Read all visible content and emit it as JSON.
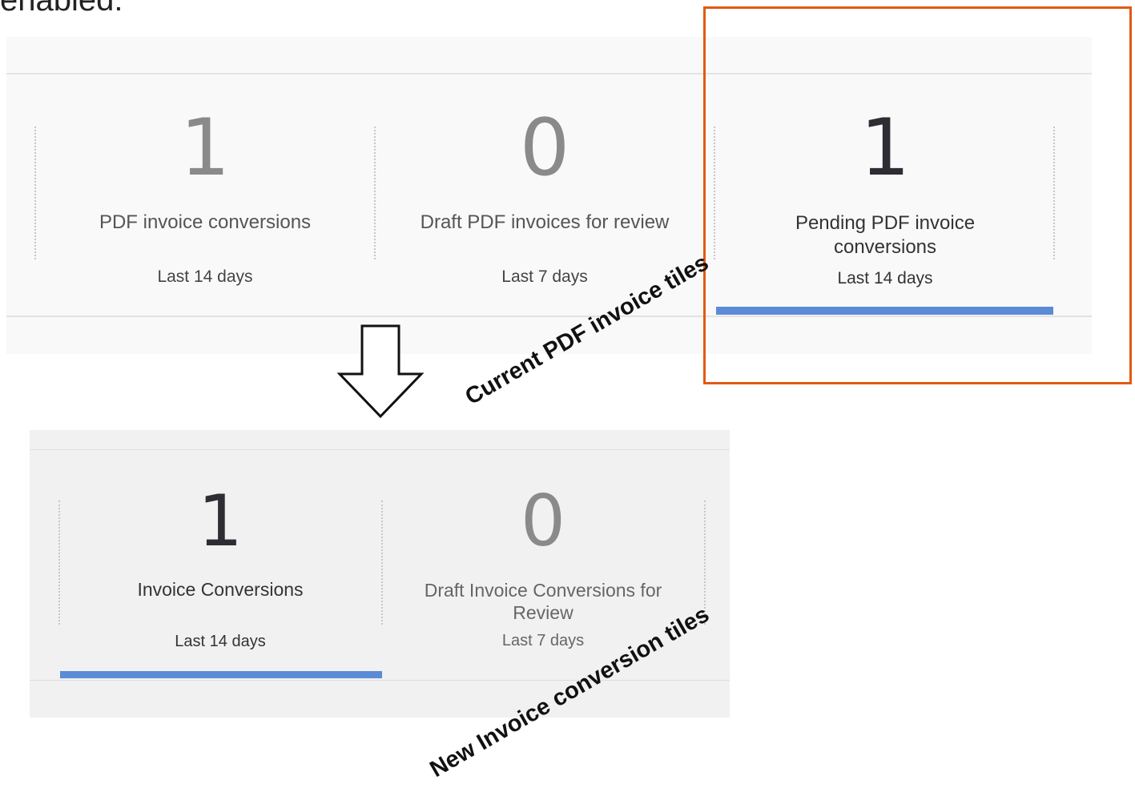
{
  "header_text": "enabled:",
  "current_tiles": [
    {
      "value": "1",
      "label": "PDF invoice conversions",
      "period": "Last 14 days"
    },
    {
      "value": "0",
      "label": "Draft PDF invoices for review",
      "period": "Last 7 days"
    },
    {
      "value": "1",
      "label": "Pending PDF invoice conversions",
      "period": "Last 14 days"
    }
  ],
  "new_tiles": [
    {
      "value": "1",
      "label": "Invoice Conversions",
      "period": "Last 14 days"
    },
    {
      "value": "0",
      "label": "Draft Invoice Conversions for Review",
      "period": "Last 7 days"
    }
  ],
  "annotations": {
    "current": "Current PDF invoice tiles",
    "new": "New Invoice conversion tiles"
  },
  "colors": {
    "highlight_border": "#e15a12",
    "selected_underline": "#5b8bd6"
  },
  "icons": {
    "transition_arrow": "down-arrow-icon"
  }
}
